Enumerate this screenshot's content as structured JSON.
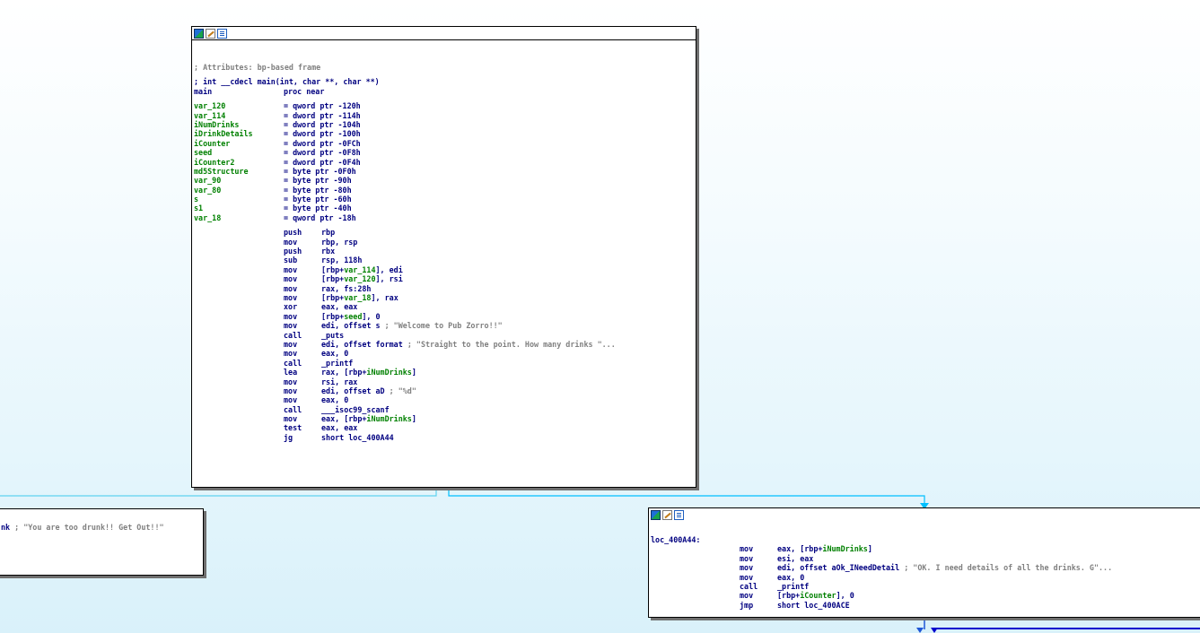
{
  "main_node": {
    "lines": [
      {
        "t": "comment",
        "text": "; Attributes: bp-based frame"
      },
      {
        "t": "gap"
      },
      {
        "t": "proto",
        "text": "; int __cdecl main(int, char **, char **)"
      },
      {
        "t": "plain",
        "label": "main",
        "mn": "proc near",
        "op": ""
      },
      {
        "t": "gap"
      },
      {
        "t": "var",
        "label": "var_120",
        "op": "= qword ptr -120h"
      },
      {
        "t": "var",
        "label": "var_114",
        "op": "= dword ptr -114h"
      },
      {
        "t": "var",
        "label": "iNumDrinks",
        "op": "= dword ptr -104h"
      },
      {
        "t": "var",
        "label": "iDrinkDetails",
        "op": "= dword ptr -100h"
      },
      {
        "t": "var",
        "label": "iCounter",
        "op": "= dword ptr -0FCh"
      },
      {
        "t": "var",
        "label": "seed",
        "op": "= dword ptr -0F8h"
      },
      {
        "t": "var",
        "label": "iCounter2",
        "op": "= dword ptr -0F4h"
      },
      {
        "t": "var",
        "label": "md5Structure",
        "op": "= byte ptr -0F0h"
      },
      {
        "t": "var",
        "label": "var_90",
        "op": "= byte ptr -90h"
      },
      {
        "t": "var",
        "label": "var_80",
        "op": "= byte ptr -80h"
      },
      {
        "t": "var",
        "label": "s",
        "op": "= byte ptr -60h"
      },
      {
        "t": "var",
        "label": "s1",
        "op": "= byte ptr -40h"
      },
      {
        "t": "var",
        "label": "var_18",
        "op": "= qword ptr -18h"
      },
      {
        "t": "gap"
      },
      {
        "t": "ins",
        "mn": "push",
        "parts": [
          [
            "b",
            "rbp"
          ]
        ]
      },
      {
        "t": "ins",
        "mn": "mov",
        "parts": [
          [
            "b",
            "rbp, rsp"
          ]
        ]
      },
      {
        "t": "ins",
        "mn": "push",
        "parts": [
          [
            "b",
            "rbx"
          ]
        ]
      },
      {
        "t": "ins",
        "mn": "sub",
        "parts": [
          [
            "b",
            "rsp, 118h"
          ]
        ]
      },
      {
        "t": "ins",
        "mn": "mov",
        "parts": [
          [
            "b",
            "[rbp+"
          ],
          [
            "g",
            "var_114"
          ],
          [
            "b",
            "], edi"
          ]
        ]
      },
      {
        "t": "ins",
        "mn": "mov",
        "parts": [
          [
            "b",
            "[rbp+"
          ],
          [
            "g",
            "var_120"
          ],
          [
            "b",
            "], rsi"
          ]
        ]
      },
      {
        "t": "ins",
        "mn": "mov",
        "parts": [
          [
            "b",
            "rax, fs:28h"
          ]
        ]
      },
      {
        "t": "ins",
        "mn": "mov",
        "parts": [
          [
            "b",
            "[rbp+"
          ],
          [
            "g",
            "var_18"
          ],
          [
            "b",
            "], rax"
          ]
        ]
      },
      {
        "t": "ins",
        "mn": "xor",
        "parts": [
          [
            "b",
            "eax, eax"
          ]
        ]
      },
      {
        "t": "ins",
        "mn": "mov",
        "parts": [
          [
            "b",
            "[rbp+"
          ],
          [
            "g",
            "seed"
          ],
          [
            "b",
            "], 0"
          ]
        ]
      },
      {
        "t": "ins",
        "mn": "mov",
        "parts": [
          [
            "b",
            "edi, offset s "
          ],
          [
            "c",
            "; \"Welcome to Pub Zorro!!\""
          ]
        ]
      },
      {
        "t": "ins",
        "mn": "call",
        "parts": [
          [
            "b",
            "_puts"
          ]
        ]
      },
      {
        "t": "ins",
        "mn": "mov",
        "parts": [
          [
            "b",
            "edi, offset format "
          ],
          [
            "c",
            "; \"Straight to the point. How many drinks \"..."
          ]
        ]
      },
      {
        "t": "ins",
        "mn": "mov",
        "parts": [
          [
            "b",
            "eax, 0"
          ]
        ]
      },
      {
        "t": "ins",
        "mn": "call",
        "parts": [
          [
            "b",
            "_printf"
          ]
        ]
      },
      {
        "t": "ins",
        "mn": "lea",
        "parts": [
          [
            "b",
            "rax, [rbp+"
          ],
          [
            "g",
            "iNumDrinks"
          ],
          [
            "b",
            "]"
          ]
        ]
      },
      {
        "t": "ins",
        "mn": "mov",
        "parts": [
          [
            "b",
            "rsi, rax"
          ]
        ]
      },
      {
        "t": "ins",
        "mn": "mov",
        "parts": [
          [
            "b",
            "edi, offset aD "
          ],
          [
            "c",
            "; \"%d\""
          ]
        ]
      },
      {
        "t": "ins",
        "mn": "mov",
        "parts": [
          [
            "b",
            "eax, 0"
          ]
        ]
      },
      {
        "t": "ins",
        "mn": "call",
        "parts": [
          [
            "b",
            "___isoc99_scanf"
          ]
        ]
      },
      {
        "t": "ins",
        "mn": "mov",
        "parts": [
          [
            "b",
            "eax, [rbp+"
          ],
          [
            "g",
            "iNumDrinks"
          ],
          [
            "b",
            "]"
          ]
        ]
      },
      {
        "t": "ins",
        "mn": "test",
        "parts": [
          [
            "b",
            "eax, eax"
          ]
        ]
      },
      {
        "t": "ins",
        "mn": "jg",
        "parts": [
          [
            "b",
            "short loc_400A44"
          ]
        ]
      }
    ]
  },
  "left_node": {
    "lines": [
      {
        "t": "raw",
        "parts": [
          [
            "b",
            "nk "
          ],
          [
            "c",
            "; \"You are too drunk!! Get Out!!\""
          ]
        ]
      }
    ]
  },
  "right_node": {
    "lines": [
      {
        "t": "label",
        "text": "loc_400A44:"
      },
      {
        "t": "ins",
        "mn": "mov",
        "parts": [
          [
            "b",
            "eax, [rbp+"
          ],
          [
            "g",
            "iNumDrinks"
          ],
          [
            "b",
            "]"
          ]
        ]
      },
      {
        "t": "ins",
        "mn": "mov",
        "parts": [
          [
            "b",
            "esi, eax"
          ]
        ]
      },
      {
        "t": "ins",
        "mn": "mov",
        "parts": [
          [
            "b",
            "edi, offset aOk_INeedDetail "
          ],
          [
            "c",
            "; \"OK. I need details of all the drinks. G\"..."
          ]
        ]
      },
      {
        "t": "ins",
        "mn": "mov",
        "parts": [
          [
            "b",
            "eax, 0"
          ]
        ]
      },
      {
        "t": "ins",
        "mn": "call",
        "parts": [
          [
            "b",
            "_printf"
          ]
        ]
      },
      {
        "t": "ins",
        "mn": "mov",
        "parts": [
          [
            "b",
            "[rbp+"
          ],
          [
            "g",
            "iCounter"
          ],
          [
            "b",
            "], 0"
          ]
        ]
      },
      {
        "t": "ins",
        "mn": "jmp",
        "parts": [
          [
            "b",
            "short loc_400ACE"
          ]
        ]
      }
    ]
  },
  "colors": {
    "edge_true": "#00bfff",
    "edge_false": "#1e90ff",
    "edge_jump": "#0000cd"
  },
  "toolbar_icons": [
    "graph-view-icon",
    "edit-icon",
    "listing-icon"
  ]
}
